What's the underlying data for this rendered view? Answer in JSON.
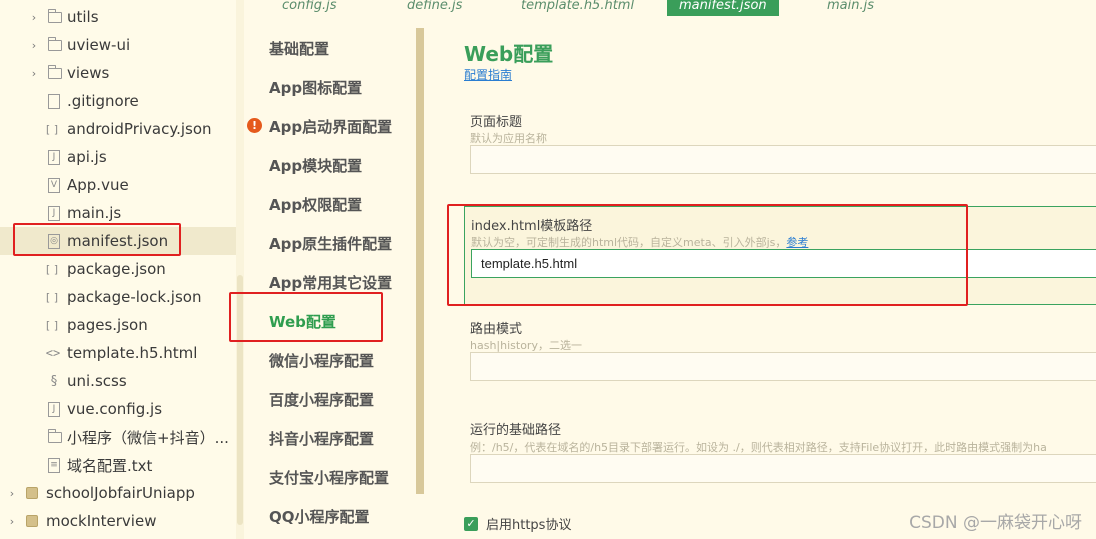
{
  "explorer": {
    "items": [
      {
        "label": "utils",
        "type": "folder",
        "icon": "folder-icon"
      },
      {
        "label": "uview-ui",
        "type": "folder",
        "icon": "folder-icon"
      },
      {
        "label": "views",
        "type": "folder",
        "icon": "folder-icon"
      },
      {
        "label": ".gitignore",
        "type": "file",
        "icon": "file-icon"
      },
      {
        "label": "androidPrivacy.json",
        "type": "json",
        "icon": "json-icon"
      },
      {
        "label": "api.js",
        "type": "js",
        "icon": "js-file-icon"
      },
      {
        "label": "App.vue",
        "type": "vue",
        "icon": "vue-file-icon"
      },
      {
        "label": "main.js",
        "type": "js",
        "icon": "js-file-icon"
      },
      {
        "label": "manifest.json",
        "type": "manifest",
        "icon": "manifest-icon"
      },
      {
        "label": "package.json",
        "type": "json",
        "icon": "json-icon"
      },
      {
        "label": "package-lock.json",
        "type": "json",
        "icon": "json-icon"
      },
      {
        "label": "pages.json",
        "type": "json",
        "icon": "json-icon"
      },
      {
        "label": "template.h5.html",
        "type": "html",
        "icon": "html-icon"
      },
      {
        "label": "uni.scss",
        "type": "scss",
        "icon": "scss-icon"
      },
      {
        "label": "vue.config.js",
        "type": "js",
        "icon": "js-file-icon"
      },
      {
        "label": "小程序（微信+抖音）...",
        "type": "folder",
        "icon": "folder-icon"
      },
      {
        "label": "域名配置.txt",
        "type": "txt",
        "icon": "txt-file-icon"
      },
      {
        "label": "schoolJobfairUniapp",
        "type": "project",
        "icon": "project-icon"
      },
      {
        "label": "mockInterview",
        "type": "project",
        "icon": "project-icon"
      }
    ]
  },
  "tabs": [
    "config.js",
    "define.js",
    "template.h5.html",
    "manifest.json",
    "main.js"
  ],
  "settings_nav": {
    "items": [
      {
        "label": "基础配置"
      },
      {
        "label": "App图标配置"
      },
      {
        "label": "App启动界面配置"
      },
      {
        "label": "App模块配置"
      },
      {
        "label": "App权限配置"
      },
      {
        "label": "App原生插件配置"
      },
      {
        "label": "App常用其它设置"
      },
      {
        "label": "Web配置"
      },
      {
        "label": "微信小程序配置"
      },
      {
        "label": "百度小程序配置"
      },
      {
        "label": "抖音小程序配置"
      },
      {
        "label": "支付宝小程序配置"
      },
      {
        "label": "QQ小程序配置"
      }
    ],
    "warning_symbol": "!"
  },
  "form": {
    "title": "Web配置",
    "guide_link": "配置指南",
    "page_title_label": "页面标题",
    "page_title_hint": "默认为应用名称",
    "page_title_value": "",
    "template_label": "index.html模板路径",
    "template_hint": "默认为空，可定制生成的html代码，自定义meta、引入外部js，",
    "template_hint_link": "参考",
    "template_value": "template.h5.html",
    "router_label": "路由模式",
    "router_hint": "hash|history，二选一",
    "router_value": "",
    "base_label": "运行的基础路径",
    "base_hint": "例：/h5/，代表在域名的/h5目录下部署运行。如设为 ./，则代表相对路径，支持File协议打开，此时路由模式强制为ha",
    "base_value": "",
    "https_label": "启用https协议",
    "https_checked": true,
    "check_symbol": "✓"
  },
  "watermark": "CSDN @一麻袋开心呀",
  "colors": {
    "accent": "#3a9e5a",
    "highlight_border": "#e02020",
    "link": "#2a7dd1",
    "background": "#fffae8"
  }
}
